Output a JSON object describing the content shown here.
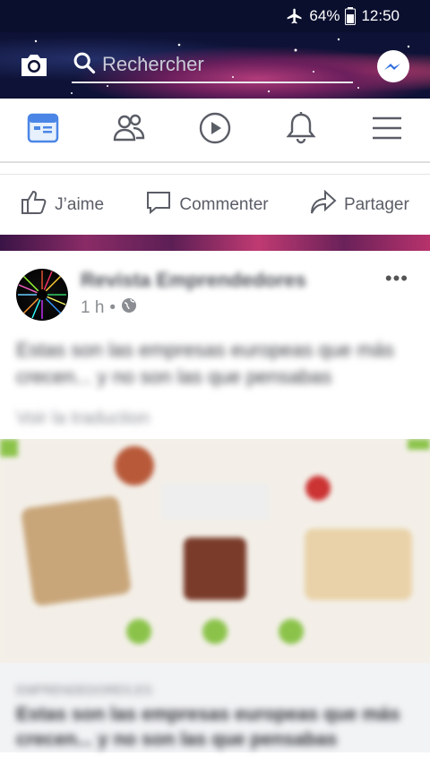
{
  "status_bar": {
    "battery": "64%",
    "time": "12:50"
  },
  "header": {
    "search_placeholder": "Rechercher"
  },
  "nav_tabs": [
    {
      "icon": "news-feed-icon",
      "active": true
    },
    {
      "icon": "friends-icon"
    },
    {
      "icon": "watch-icon"
    },
    {
      "icon": "notifications-icon"
    },
    {
      "icon": "menu-icon"
    }
  ],
  "actions": {
    "like": "J’aime",
    "comment": "Commenter",
    "share": "Partager"
  },
  "post": {
    "author": "Revista Emprendedores",
    "time": "1 h",
    "text": "Estas son las empresas europeas que más crecen... y no son las que pensabas",
    "see_translation": "Voir la traduction",
    "link_domain": "EMPRENDEDORES.ES",
    "link_title": "Estas son las empresas europeas que más crecen... y no son las que pensabas"
  },
  "colors": {
    "accent": "#4267b2",
    "icon_gray": "#5a5d66",
    "status_bar_bg": "#0a0f2e"
  }
}
